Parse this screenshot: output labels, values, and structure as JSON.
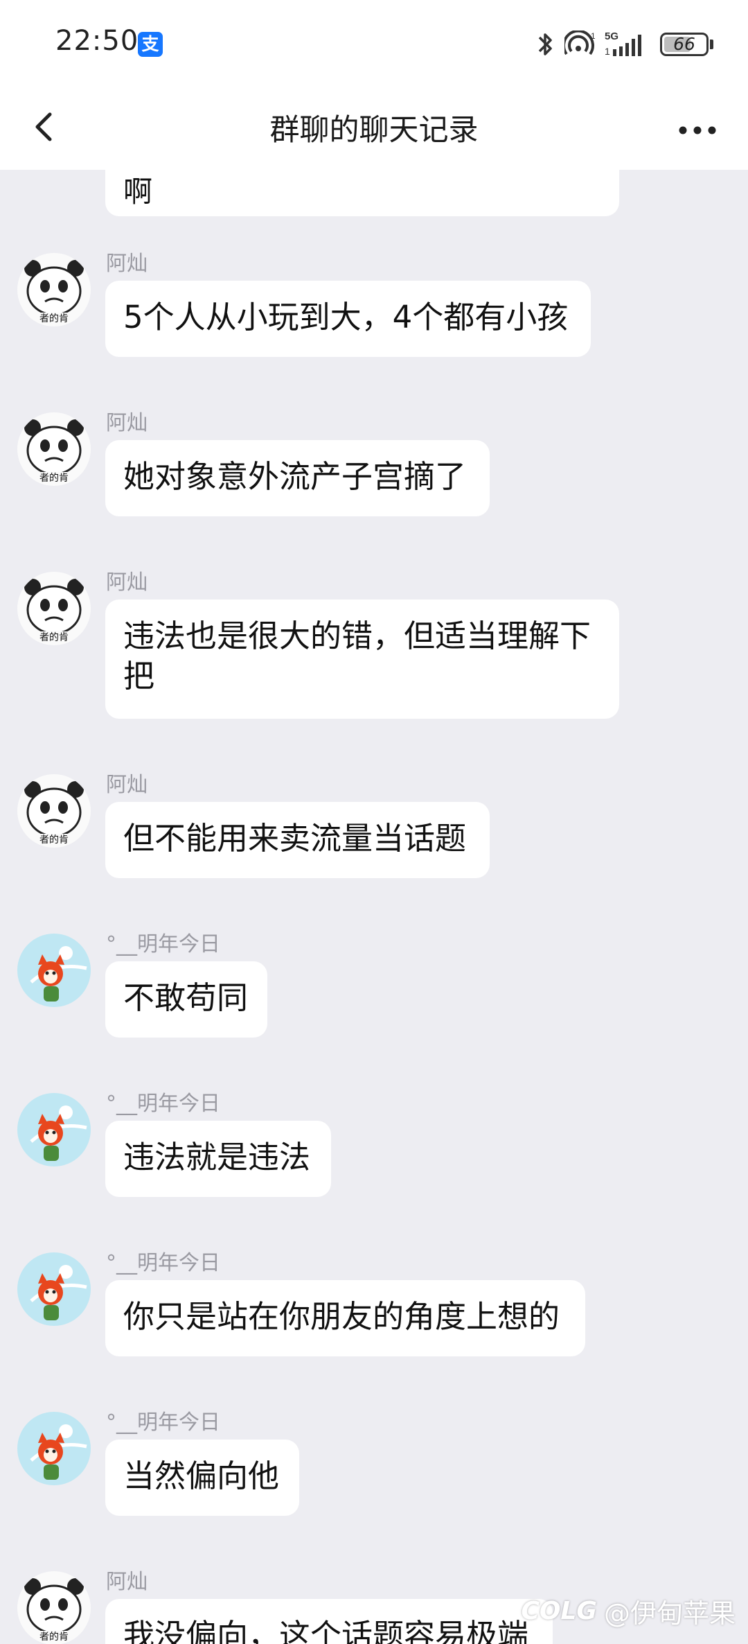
{
  "status_bar": {
    "time": "22:50",
    "alipay_badge": "支",
    "network": "5G",
    "battery": "66",
    "battery_level": 0.66,
    "icons": [
      "bluetooth-icon",
      "hotspot-icon",
      "signal-icon",
      "battery-icon"
    ]
  },
  "nav": {
    "title": "群聊的聊天记录",
    "back_icon": "chevron-left-icon",
    "more_icon": "more-dots-icon"
  },
  "partial_top_message": {
    "text": "啊"
  },
  "messages": [
    {
      "sender": "阿灿",
      "avatar": "panda-meme-avatar",
      "text": "5个人从小玩到大，4个都有小孩"
    },
    {
      "sender": "阿灿",
      "avatar": "panda-meme-avatar",
      "text": "她对象意外流产子宫摘了"
    },
    {
      "sender": "阿灿",
      "avatar": "panda-meme-avatar",
      "text_lines": [
        "违法也是很大的错，但适当理解下",
        "把"
      ]
    },
    {
      "sender": "阿灿",
      "avatar": "panda-meme-avatar",
      "text": "但不能用来卖流量当话题"
    },
    {
      "sender": "°__明年今日",
      "avatar": "fox-girl-avatar",
      "text": "不敢苟同"
    },
    {
      "sender": "°__明年今日",
      "avatar": "fox-girl-avatar",
      "text": "违法就是违法"
    },
    {
      "sender": "°__明年今日",
      "avatar": "fox-girl-avatar",
      "text": "你只是站在你朋友的角度上想的"
    },
    {
      "sender": "°__明年今日",
      "avatar": "fox-girl-avatar",
      "text": "当然偏向他"
    },
    {
      "sender": "阿灿",
      "avatar": "panda-meme-avatar",
      "text": "我没偏向，这个话题容易极端"
    }
  ],
  "watermark": {
    "logo": "COLG",
    "text": "@伊甸苹果"
  },
  "colors": {
    "background": "#ededf2",
    "bubble": "#ffffff",
    "sender": "#9a9aa2",
    "accent_alipay": "#1677ff"
  }
}
